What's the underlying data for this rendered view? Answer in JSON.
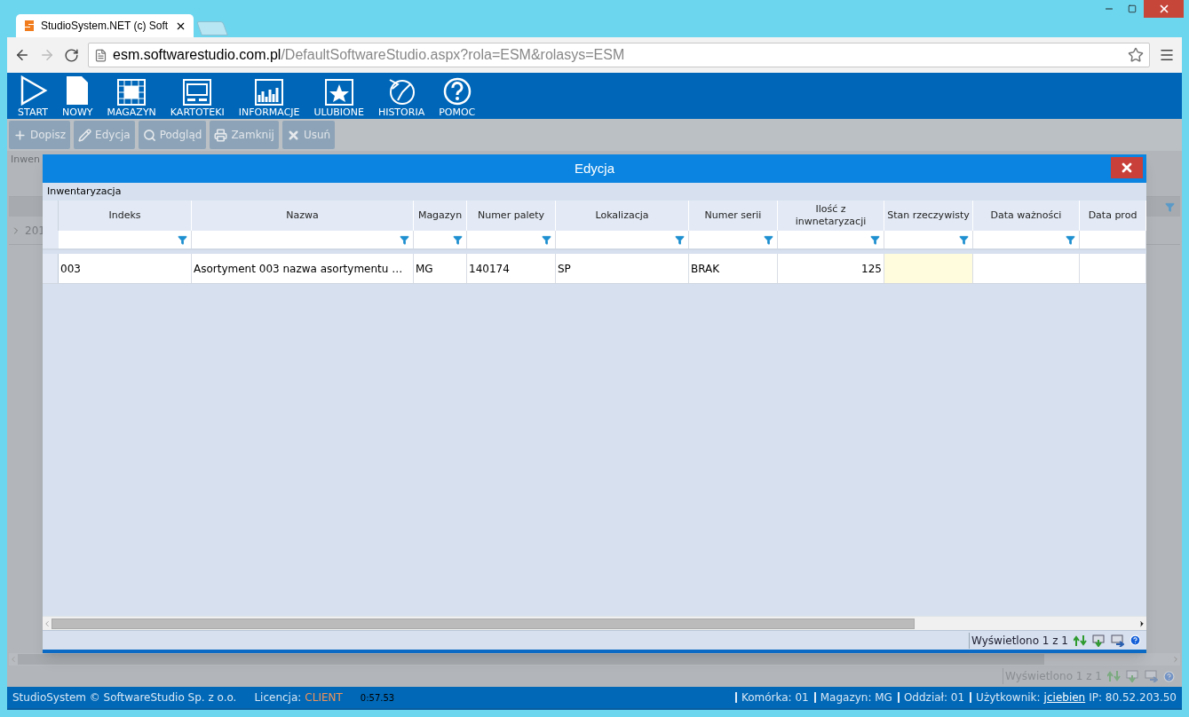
{
  "browser": {
    "tab_title": "StudioSystem.NET (c) Soft",
    "url_host": "esm.softwarestudio.com.pl",
    "url_path": "/DefaultSoftwareStudio.aspx?rola=ESM&rolasys=ESM"
  },
  "menu": [
    {
      "label": "START",
      "kind": "play"
    },
    {
      "label": "NOWY",
      "kind": "page"
    },
    {
      "label": "MAGAZYN",
      "kind": "grid"
    },
    {
      "label": "KARTOTEKI",
      "kind": "window"
    },
    {
      "label": "INFORMACJE",
      "kind": "chart"
    },
    {
      "label": "ULUBIONE",
      "kind": "star"
    },
    {
      "label": "HISTORIA",
      "kind": "history"
    },
    {
      "label": "POMOC",
      "kind": "help"
    }
  ],
  "actions": [
    {
      "label": "Dopisz",
      "kind": "plus",
      "disabled": true
    },
    {
      "label": "Edycja",
      "kind": "edit",
      "disabled": true
    },
    {
      "label": "Podgląd",
      "kind": "search",
      "disabled": true
    },
    {
      "label": "Zamknij",
      "kind": "save",
      "disabled": true
    },
    {
      "label": "Usuń",
      "kind": "delete",
      "disabled": true
    }
  ],
  "background_page": {
    "caption": "Inwen",
    "row_cell": "201",
    "footer": "Wyświetlono 1 z 1"
  },
  "dialog": {
    "title": "Edycja",
    "caption": "Inwentaryzacja",
    "columns": [
      {
        "label": "Indeks",
        "filter": true
      },
      {
        "label": "Nazwa",
        "filter": true
      },
      {
        "label": "Magazyn",
        "filter": true
      },
      {
        "label": "Numer palety",
        "filter": true
      },
      {
        "label": "Lokalizacja",
        "filter": true
      },
      {
        "label": "Numer serii",
        "filter": true
      },
      {
        "label": "Ilość z inwnetaryzacji",
        "filter": true
      },
      {
        "label": "Stan rzeczywisty",
        "filter": true
      },
      {
        "label": "Data ważności",
        "filter": true
      },
      {
        "label": "Data prod",
        "filter": false
      }
    ],
    "rows": [
      {
        "cells": [
          {
            "kind": "text",
            "text": "003"
          },
          {
            "kind": "text",
            "text": "Asortyment 003 nazwa asortymentu …"
          },
          {
            "kind": "text",
            "text": "MG"
          },
          {
            "kind": "text",
            "text": "140174"
          },
          {
            "kind": "text",
            "text": "SP"
          },
          {
            "kind": "text",
            "text": "BRAK"
          },
          {
            "kind": "number",
            "text": "125"
          },
          {
            "kind": "input"
          },
          {
            "kind": "empty"
          },
          {
            "kind": "empty"
          }
        ]
      }
    ],
    "footer": "Wyświetlono 1 z 1"
  },
  "status_bar": {
    "company": "StudioSystem © SoftwareStudio Sp. z o.o.",
    "license_label": "Licencja:",
    "license": "CLIENT",
    "timer": "0:57.53",
    "items": [
      "Komórka: 01",
      "Magazyn: MG",
      "Oddział: 01"
    ],
    "user_label": "Użytkownik:",
    "user": "jciebien",
    "ip": "IP: 80.52.203.50"
  }
}
